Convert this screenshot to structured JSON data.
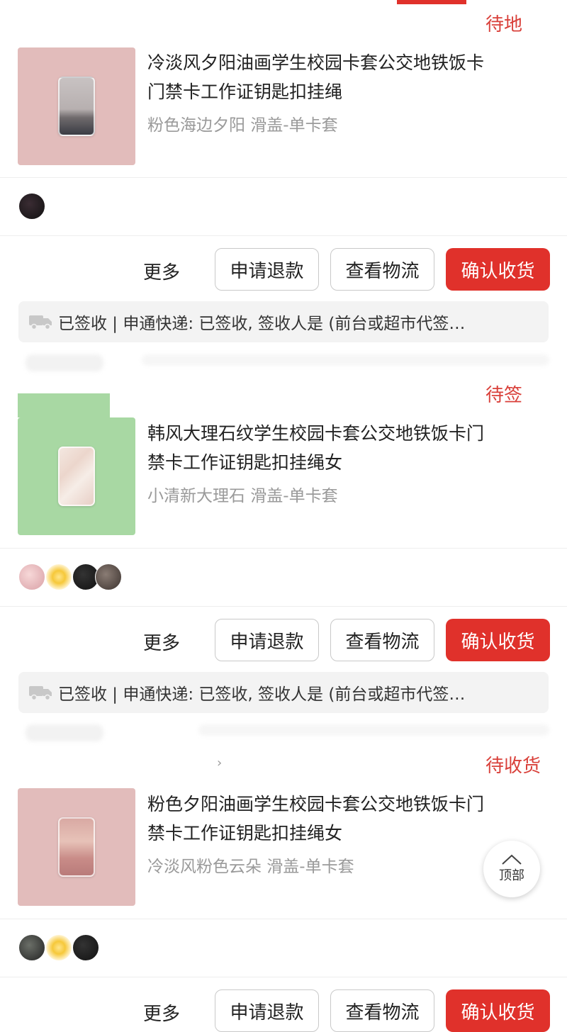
{
  "colors": {
    "accent": "#e0312b"
  },
  "orders": [
    {
      "status": "待地",
      "title": "冷淡风夕阳油画学生校园卡套公交地铁饭卡门禁卡工作证钥匙扣挂绳",
      "spec": "粉色海边夕阳 滑盖-单卡套",
      "logistics": "已签收 | 申通快递: 已签收, 签收人是 (前台或超市代签…",
      "thumb_color": "#e2bcbb"
    },
    {
      "status": "待签",
      "title": "韩风大理石纹学生校园卡套公交地铁饭卡门禁卡工作证钥匙扣挂绳女",
      "spec": "小清新大理石 滑盖-单卡套",
      "logistics": "已签收 | 申通快递: 已签收, 签收人是 (前台或超市代签…",
      "thumb_color": "#a8d8a3"
    },
    {
      "status": "待收货",
      "title": "粉色夕阳油画学生校园卡套公交地铁饭卡门禁卡工作证钥匙扣挂绳女",
      "spec": "冷淡风粉色云朵 滑盖-单卡套"
    }
  ],
  "actions": {
    "more": "更多",
    "refund": "申请退款",
    "logistics": "查看物流",
    "confirm": "确认收货"
  },
  "back_to_top": "顶部"
}
